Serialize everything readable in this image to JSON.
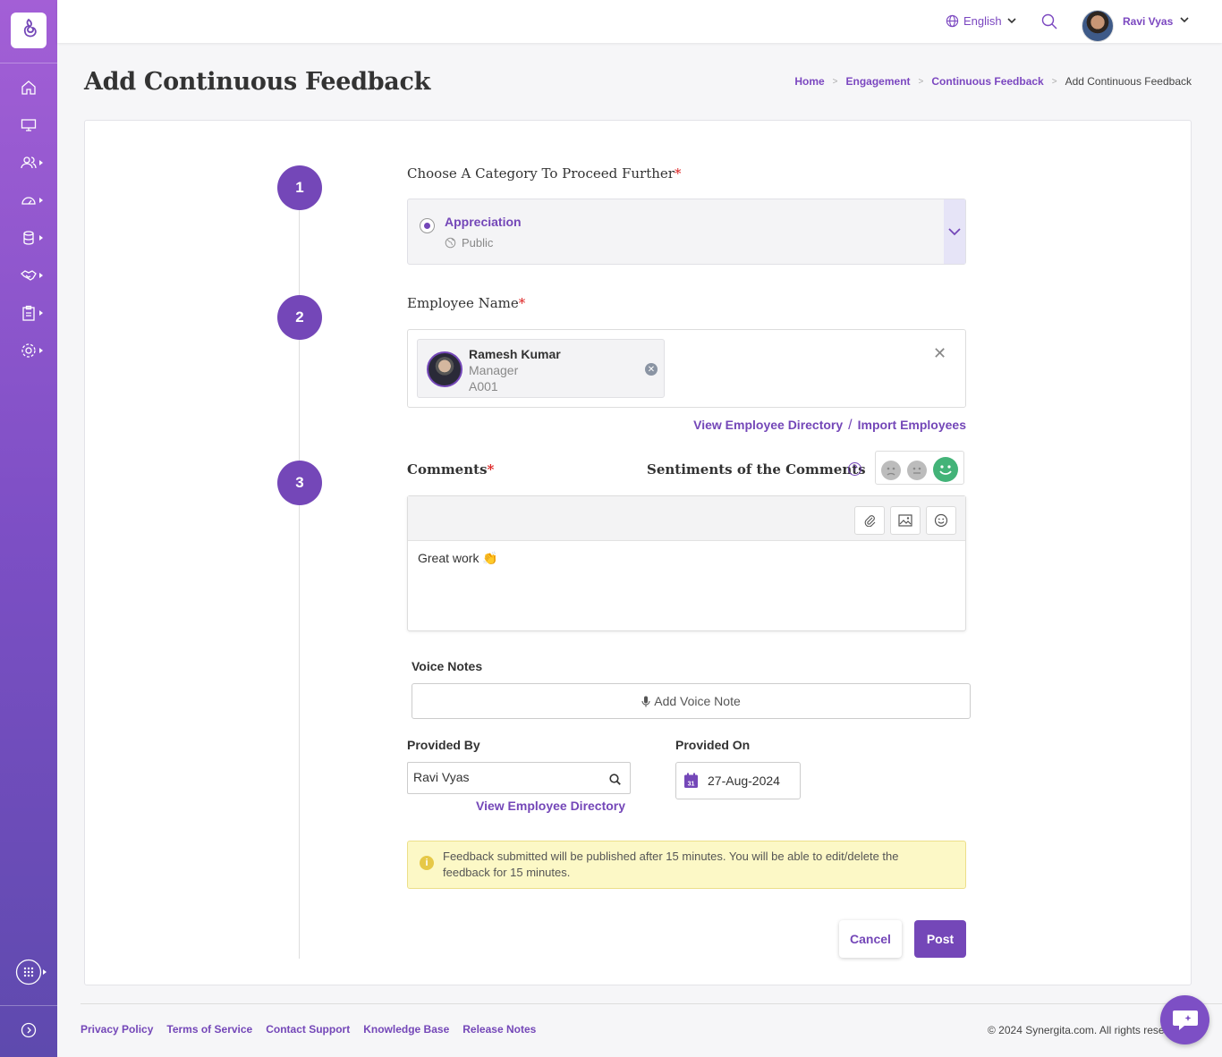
{
  "app": {
    "brand_color": "#7447b8"
  },
  "sidebar": {
    "items": [
      {
        "icon": "home-icon"
      },
      {
        "icon": "monitor-icon"
      },
      {
        "icon": "users-icon"
      },
      {
        "icon": "dashboard-icon"
      },
      {
        "icon": "database-icon"
      },
      {
        "icon": "handshake-icon"
      },
      {
        "icon": "clipboard-icon"
      },
      {
        "icon": "settings-icon"
      }
    ],
    "apps_icon": "apps-grid-icon",
    "expand_icon": "expand-icon"
  },
  "topbar": {
    "language": "English",
    "user_name": "Ravi Vyas"
  },
  "page": {
    "title": "Add Continuous Feedback",
    "breadcrumbs": [
      "Home",
      "Engagement",
      "Continuous Feedback",
      "Add Continuous Feedback"
    ]
  },
  "form": {
    "steps": [
      "1",
      "2",
      "3"
    ],
    "category": {
      "label": "Choose A Category To Proceed Further",
      "required_mark": "*",
      "selected": "Appreciation",
      "visibility": "Public"
    },
    "employee": {
      "label": "Employee Name",
      "required_mark": "*",
      "selected": {
        "name": "Ramesh Kumar",
        "role": "Manager",
        "code": "A001"
      },
      "link_directory": "View Employee Directory",
      "link_separator": "/",
      "link_import": "Import Employees"
    },
    "comments": {
      "label": "Comments",
      "required_mark": "*",
      "sentiment_label": "Sentiments of the Comments",
      "sentiment_selected": "positive",
      "text": "Great work 👏"
    },
    "voice_notes": {
      "label": "Voice Notes",
      "button": "Add Voice Note"
    },
    "provided_by": {
      "label": "Provided By",
      "value": "Ravi Vyas",
      "link": "View Employee Directory"
    },
    "provided_on": {
      "label": "Provided On",
      "value": "27-Aug-2024",
      "calendar_day": "31"
    },
    "notice": "Feedback submitted will be published after 15 minutes. You will be able to edit/delete the feedback for 15 minutes.",
    "buttons": {
      "cancel": "Cancel",
      "post": "Post"
    }
  },
  "footer": {
    "links": [
      "Privacy Policy",
      "Terms of Service",
      "Contact Support",
      "Knowledge Base",
      "Release Notes"
    ],
    "copyright": "© 2024 Synergita.com. All rights reserved."
  }
}
